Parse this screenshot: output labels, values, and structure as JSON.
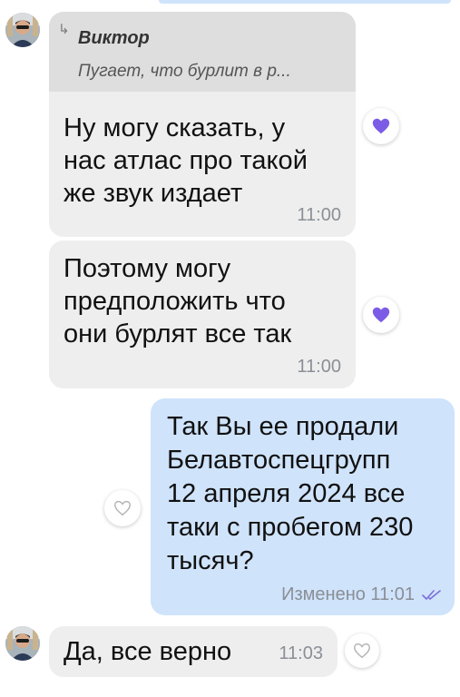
{
  "messages": [
    {
      "type": "incoming",
      "reply": {
        "author": "Виктор",
        "text": "Пугает, что бурлит в р..."
      },
      "lines": [
        "Ну могу сказать, у",
        "нас атлас про такой",
        "же звук издает"
      ],
      "time": "11:00",
      "reaction": "liked"
    },
    {
      "type": "incoming",
      "lines": [
        "Поэтому могу",
        "предположить что",
        "они бурлят все так"
      ],
      "time": "11:00",
      "reaction": "liked"
    },
    {
      "type": "outgoing",
      "lines": [
        "Так Вы ее продали",
        "Белавтоспецгрупп",
        "12 апреля 2024 все",
        "таки с пробегом 230",
        "тысяч?"
      ],
      "status": "Изменено 11:01",
      "reaction": "none"
    },
    {
      "type": "incoming",
      "lines": [
        "Да, все верно"
      ],
      "time": "11:03",
      "reaction": "none"
    }
  ],
  "colors": {
    "incoming_bubble": "#eeeeee",
    "outgoing_bubble": "#cfe3fb",
    "reaction_heart": "#7c5ce6",
    "read_ticks": "#7c6fd8"
  },
  "icons": {
    "reply": "reply-arrow-icon",
    "liked": "heart-filled-icon",
    "empty_reaction": "heart-outline-icon",
    "read_status": "double-check-icon"
  }
}
